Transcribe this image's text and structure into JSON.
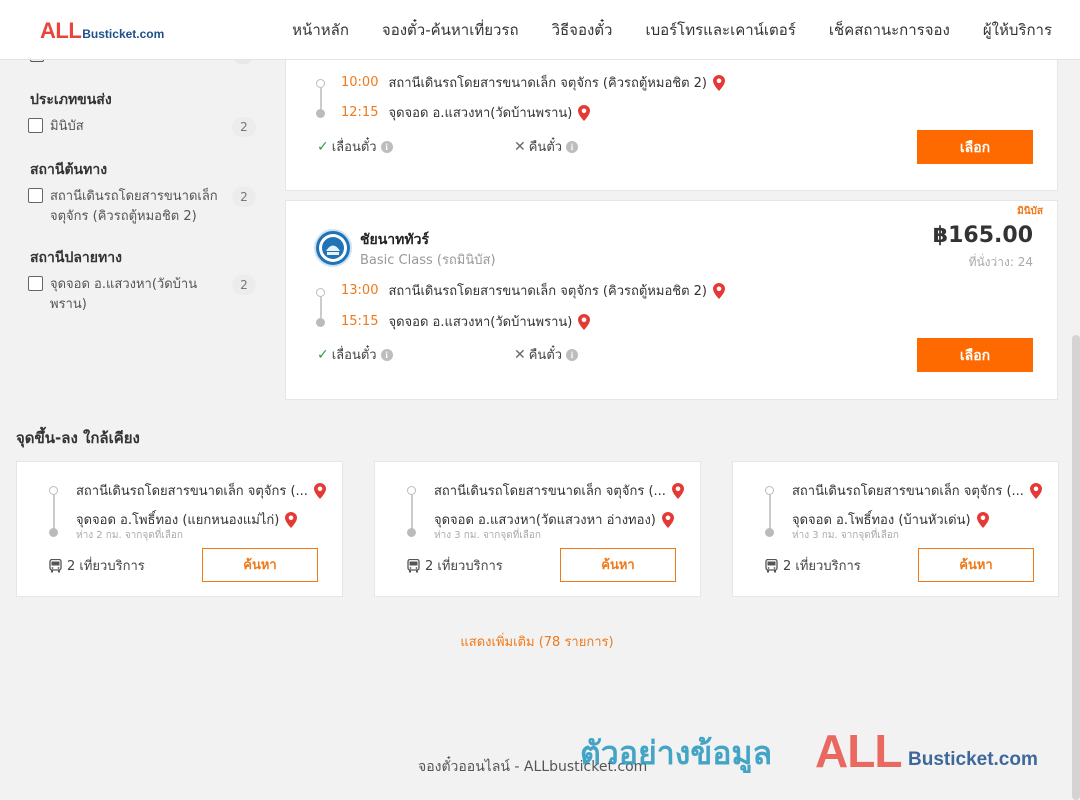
{
  "header": {
    "logo_all": "ALL",
    "logo_bus": "Busticket.com",
    "nav": [
      "หน้าหลัก",
      "จองตั๋ว-ค้นหาเที่ยวรถ",
      "วิธีจองตั๋ว",
      "เบอร์โทรและเคาน์เตอร์",
      "เช็คสถานะการจอง",
      "ผู้ให้บริการ"
    ]
  },
  "sidebar": {
    "groups": [
      {
        "title": "ประเภทขนส่ง",
        "items": [
          {
            "label": "มินิบัส",
            "count": "2"
          }
        ]
      },
      {
        "title": "สถานีต้นทาง",
        "items": [
          {
            "label": "สถานีเดินรถโดยสารขนาดเล็ก จตุจักร (คิวรถตู้หมอชิต 2)",
            "count": "2"
          }
        ]
      },
      {
        "title": "สถานีปลายทาง",
        "items": [
          {
            "label": "จุดจอด อ.แสวงหา(วัดบ้านพราน)",
            "count": "2"
          }
        ]
      }
    ]
  },
  "trips": [
    {
      "depart_time": "10:00",
      "depart_place": "สถานีเดินรถโดยสารขนาดเล็ก จตุจักร (คิวรถตู้หมอชิต 2)",
      "arrive_time": "12:15",
      "arrive_place": "จุดจอด อ.แสวงหา(วัดบ้านพราน)",
      "reschedule": "เลื่อนตั๋ว",
      "refund": "คืนตั๋ว",
      "select_label": "เลือก"
    },
    {
      "badge": "มินิบัส",
      "operator": "ชัยนาททัวร์",
      "class": "Basic Class (รถมินิบัส)",
      "price": "฿165.00",
      "seats": "ที่นั่งว่าง: 24",
      "depart_time": "13:00",
      "depart_place": "สถานีเดินรถโดยสารขนาดเล็ก จตุจักร (คิวรถตู้หมอชิต 2)",
      "arrive_time": "15:15",
      "arrive_place": "จุดจอด อ.แสวงหา(วัดบ้านพราน)",
      "reschedule": "เลื่อนตั๋ว",
      "refund": "คืนตั๋ว",
      "select_label": "เลือก"
    }
  ],
  "nearby": {
    "title": "จุดขึ้น-ลง ใกล้เคียง",
    "cards": [
      {
        "from": "สถานีเดินรถโดยสารขนาดเล็ก จตุจักร (...",
        "to": "จุดจอด อ.โพธิ์ทอง (แยกหนองแม่ไก่)",
        "distance": "ห่าง 2 กม. จากจุดที่เลือก",
        "trips": "2 เที่ยวบริการ",
        "search_label": "ค้นหา"
      },
      {
        "from": "สถานีเดินรถโดยสารขนาดเล็ก จตุจักร (...",
        "to": "จุดจอด อ.แสวงหา(วัดแสวงหา อ่างทอง)",
        "distance": "ห่าง 3 กม. จากจุดที่เลือก",
        "trips": "2 เที่ยวบริการ",
        "search_label": "ค้นหา"
      },
      {
        "from": "สถานีเดินรถโดยสารขนาดเล็ก จตุจักร (...",
        "to": "จุดจอด อ.โพธิ์ทอง (บ้านหัวเด่น)",
        "distance": "ห่าง 3 กม. จากจุดที่เลือก",
        "trips": "2 เที่ยวบริการ",
        "search_label": "ค้นหา"
      }
    ]
  },
  "show_more": "แสดงเพิ่มเติม (78 รายการ)",
  "footer": "จองตั๋วออนไลน์ - ALLbusticket.com",
  "watermark": {
    "thai": "ตัวอย่างข้อมูล",
    "all": "ALL",
    "bus": "Busticket.com"
  },
  "colors": {
    "accent": "#ff6a00",
    "price_text": "#333333",
    "time_text": "#f07a1a"
  }
}
